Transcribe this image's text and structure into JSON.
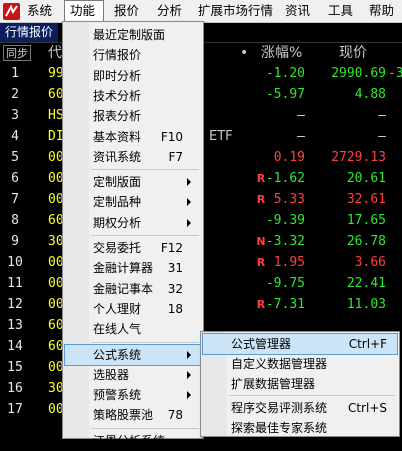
{
  "menubar": {
    "items": [
      "系统",
      "功能",
      "报价",
      "分析",
      "扩展市场行情",
      "资讯",
      "工具",
      "帮助"
    ]
  },
  "tab": {
    "label": "行情报价"
  },
  "header": {
    "sync": "同步",
    "code_partial": "代",
    "dot": "•",
    "change": "涨幅%",
    "price": "现价"
  },
  "rows": [
    {
      "n": "1",
      "code": "99",
      "flag": "",
      "change": "-1.20",
      "price": "2990.69",
      "tail": "-3"
    },
    {
      "n": "2",
      "code": "60",
      "flag": "",
      "change": "-5.97",
      "price": "4.88",
      "tail": ""
    },
    {
      "n": "3",
      "code": "HS",
      "flag": "",
      "change": "–",
      "price": "–",
      "tail": ""
    },
    {
      "n": "4",
      "code": "DI",
      "flag": "",
      "change": "–",
      "price": "–",
      "tail": "",
      "etf": "ETF"
    },
    {
      "n": "5",
      "code": "00",
      "flag": "",
      "change": "0.19",
      "price": "2729.13",
      "tail": ""
    },
    {
      "n": "6",
      "code": "00",
      "flag": "R",
      "change": "-1.62",
      "price": "20.61",
      "tail": ""
    },
    {
      "n": "7",
      "code": "00",
      "flag": "R",
      "change": "5.33",
      "price": "32.61",
      "tail": ""
    },
    {
      "n": "8",
      "code": "60",
      "flag": "",
      "change": "-9.39",
      "price": "17.65",
      "tail": ""
    },
    {
      "n": "9",
      "code": "30",
      "flag": "N",
      "change": "-3.32",
      "price": "26.78",
      "tail": ""
    },
    {
      "n": "10",
      "code": "00",
      "flag": "R",
      "change": "1.95",
      "price": "3.66",
      "tail": ""
    },
    {
      "n": "11",
      "code": "00",
      "flag": "",
      "change": "-9.75",
      "price": "22.41",
      "tail": ""
    },
    {
      "n": "12",
      "code": "00",
      "flag": "R",
      "change": "-7.31",
      "price": "11.03",
      "tail": ""
    },
    {
      "n": "13",
      "code": "60",
      "flag": "",
      "change": "",
      "price": "",
      "tail": ""
    },
    {
      "n": "14",
      "code": "60",
      "flag": "",
      "change": "",
      "price": "",
      "tail": ""
    },
    {
      "n": "15",
      "code": "00",
      "flag": "",
      "change": "",
      "price": "",
      "tail": ""
    },
    {
      "n": "16",
      "code": "30",
      "flag": "",
      "change": "",
      "price": "",
      "tail": ""
    },
    {
      "n": "17",
      "code": "00",
      "flag": "",
      "change": "",
      "price": "",
      "tail": ""
    }
  ],
  "func_menu": {
    "items": [
      {
        "label": "最近定制版面",
        "shortcut": "",
        "arrow": false
      },
      {
        "label": "行情报价",
        "shortcut": "",
        "arrow": false
      },
      {
        "label": "即时分析",
        "shortcut": "",
        "arrow": false
      },
      {
        "label": "技术分析",
        "shortcut": "",
        "arrow": false
      },
      {
        "label": "报表分析",
        "shortcut": "",
        "arrow": false
      },
      {
        "label": "基本资料",
        "shortcut": "F10",
        "arrow": false
      },
      {
        "label": "资讯系统",
        "shortcut": "F7",
        "arrow": false
      },
      {
        "sep": true
      },
      {
        "label": "定制版面",
        "shortcut": "",
        "arrow": true
      },
      {
        "label": "定制品种",
        "shortcut": "",
        "arrow": true
      },
      {
        "label": "期权分析",
        "shortcut": "",
        "arrow": true
      },
      {
        "sep": true
      },
      {
        "label": "交易委托",
        "shortcut": "F12",
        "arrow": false
      },
      {
        "label": "金融计算器",
        "shortcut": "31",
        "arrow": false
      },
      {
        "label": "金融记事本",
        "shortcut": "32",
        "arrow": false
      },
      {
        "label": "个人理财",
        "shortcut": "18",
        "arrow": false
      },
      {
        "label": "在线人气",
        "shortcut": "",
        "arrow": false
      },
      {
        "sep": true
      },
      {
        "label": "公式系统",
        "shortcut": "",
        "arrow": true,
        "highlight": true
      },
      {
        "label": "选股器",
        "shortcut": "",
        "arrow": true
      },
      {
        "label": "预警系统",
        "shortcut": "",
        "arrow": true
      },
      {
        "label": "策略股票池",
        "shortcut": "78",
        "arrow": false
      },
      {
        "sep": true
      },
      {
        "label": "江恩分析系统",
        "shortcut": "",
        "arrow": false
      }
    ]
  },
  "formula_menu": {
    "items": [
      {
        "label": "公式管理器",
        "shortcut": "Ctrl+F",
        "highlight": true
      },
      {
        "label": "自定义数据管理器",
        "shortcut": ""
      },
      {
        "label": "扩展数据管理器",
        "shortcut": ""
      },
      {
        "sep": true
      },
      {
        "label": "程序交易评测系统",
        "shortcut": "Ctrl+S"
      },
      {
        "label": "探索最佳专家系统",
        "shortcut": ""
      }
    ]
  }
}
